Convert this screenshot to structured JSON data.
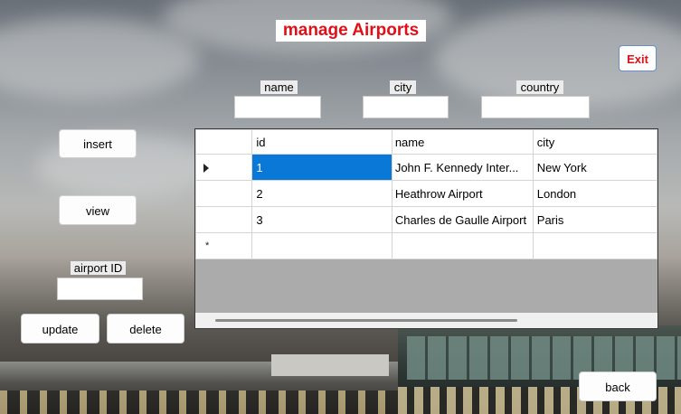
{
  "window": {
    "title": "manage Airports"
  },
  "buttons": {
    "exit": "Exit",
    "insert": "insert",
    "view": "view",
    "update": "update",
    "delete": "delete",
    "back": "back"
  },
  "fields": {
    "name": {
      "label": "name",
      "value": ""
    },
    "city": {
      "label": "city",
      "value": ""
    },
    "country": {
      "label": "country",
      "value": ""
    },
    "airport_id": {
      "label": "airport ID",
      "value": ""
    }
  },
  "grid": {
    "columns": [
      "id",
      "name",
      "city"
    ],
    "rows": [
      {
        "id": "1",
        "name": "John F. Kennedy Inter...",
        "city": "New York"
      },
      {
        "id": "2",
        "name": "Heathrow Airport",
        "city": "London"
      },
      {
        "id": "3",
        "name": "Charles de Gaulle Airport",
        "city": "Paris"
      }
    ],
    "selected_row": 0,
    "selected_column": "id",
    "new_row_marker": "*"
  },
  "colors": {
    "title_text": "#e01018",
    "selection": "#0a78d7",
    "grid_background": "#ababab"
  }
}
